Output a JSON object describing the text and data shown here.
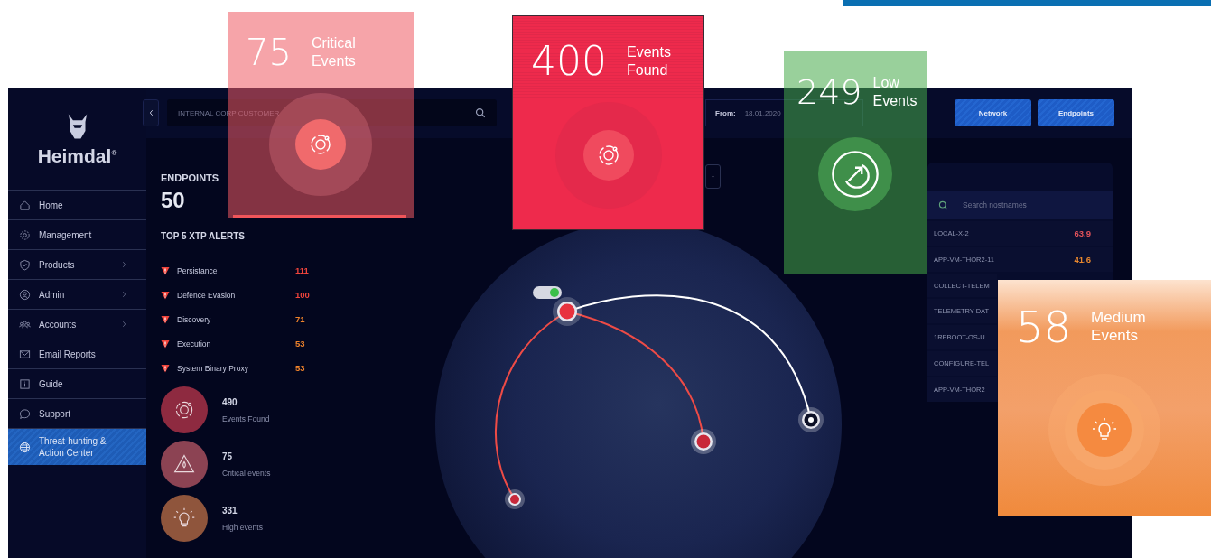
{
  "sidebar": {
    "brand": "Heimdal",
    "trademark": "®",
    "items": [
      {
        "label": "Home",
        "kind": "home",
        "has_submenu": false,
        "selected": false
      },
      {
        "label": "Management",
        "kind": "gear",
        "has_submenu": false,
        "selected": false
      },
      {
        "label": "Products",
        "kind": "shield",
        "has_submenu": true,
        "selected": false
      },
      {
        "label": "Admin",
        "kind": "user",
        "has_submenu": true,
        "selected": false
      },
      {
        "label": "Accounts",
        "kind": "users",
        "has_submenu": true,
        "selected": false
      },
      {
        "label": "Email Reports",
        "kind": "mail",
        "has_submenu": false,
        "selected": false
      },
      {
        "label": "Guide",
        "kind": "info",
        "has_submenu": false,
        "selected": false
      },
      {
        "label": "Support",
        "kind": "chat",
        "has_submenu": false,
        "selected": false
      },
      {
        "label": "Threat-hunting & Action Center",
        "kind": "globe",
        "has_submenu": false,
        "selected": true
      }
    ]
  },
  "topbar": {
    "search_value": "INTERNAL CORP CUSTOMER",
    "from_label": "From:",
    "from_date": "18.01.2020",
    "buttons": [
      "Network",
      "Endpoints"
    ]
  },
  "endpoints": {
    "label": "ENDPOINTS",
    "count": "50"
  },
  "alerts": {
    "title": "TOP 5 XTP ALERTS",
    "items": [
      {
        "name": "Persistance",
        "count": "111",
        "color": "#f0443c"
      },
      {
        "name": "Defence Evasion",
        "count": "100",
        "color": "#f0443c"
      },
      {
        "name": "Discovery",
        "count": "71",
        "color": "#f0832c"
      },
      {
        "name": "Execution",
        "count": "53",
        "color": "#f0832c"
      },
      {
        "name": "System Binary Proxy",
        "count": "53",
        "color": "#f0832c"
      }
    ]
  },
  "stats": [
    {
      "value": "490",
      "label": "Events Found",
      "kind": "found"
    },
    {
      "value": "75",
      "label": "Critical events",
      "kind": "critical"
    },
    {
      "value": "331",
      "label": "High events",
      "kind": "high"
    }
  ],
  "map": {
    "toggle_on": true
  },
  "hosts": {
    "placeholder": "Search nostnames",
    "rows": [
      {
        "name": "LOCAL-X-2",
        "score": "63.9",
        "color": "#e0525a"
      },
      {
        "name": "APP-VM-THOR2-11",
        "score": "41.6",
        "color": "#e8872e"
      },
      {
        "name": "COLLECT-TELEM"
      },
      {
        "name": "TELEMETRY-DAT"
      },
      {
        "name": "1REBOOT-OS-U"
      },
      {
        "name": "CONFIGURE-TEL"
      },
      {
        "name": "APP-VM-THOR2"
      }
    ]
  },
  "cards": [
    {
      "kind": "critical",
      "value": "75",
      "label": "Critical Events"
    },
    {
      "kind": "found",
      "value": "400",
      "label": "Events Found"
    },
    {
      "kind": "low",
      "value": "249",
      "label": "Low Events"
    },
    {
      "kind": "medium",
      "value": "58",
      "label": "Medium Events"
    }
  ]
}
